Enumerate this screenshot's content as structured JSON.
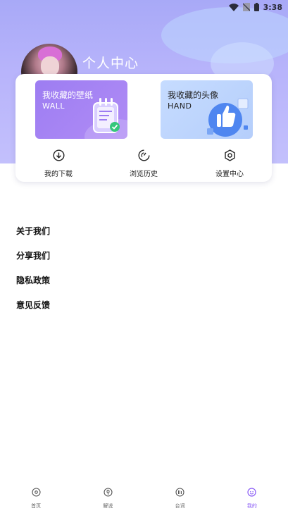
{
  "status_bar": {
    "time": "3:38"
  },
  "profile": {
    "title": "个人中心"
  },
  "favorites": {
    "wallpaper": {
      "title": "我收藏的壁纸",
      "subtitle": "WALL"
    },
    "avatar": {
      "title": "我收藏的头像",
      "subtitle": "HAND"
    }
  },
  "quick_actions": [
    {
      "label": "我的下载",
      "icon": "download-icon"
    },
    {
      "label": "浏览历史",
      "icon": "history-icon"
    },
    {
      "label": "设置中心",
      "icon": "settings-icon"
    }
  ],
  "menu": [
    {
      "label": "关于我们"
    },
    {
      "label": "分享我们"
    },
    {
      "label": "隐私政策"
    },
    {
      "label": "意见反馈"
    }
  ],
  "tabs": [
    {
      "label": "首页",
      "icon": "home-icon",
      "active": false
    },
    {
      "label": "解说",
      "icon": "commentary-icon",
      "active": false
    },
    {
      "label": "台词",
      "icon": "lines-icon",
      "active": false
    },
    {
      "label": "我的",
      "icon": "mine-icon",
      "active": true
    }
  ],
  "colors": {
    "accent": "#8a5cf6",
    "hero_top": "#a8a9f7",
    "wall_card": "#9d7df2",
    "avatar_card": "#c6dcff"
  }
}
